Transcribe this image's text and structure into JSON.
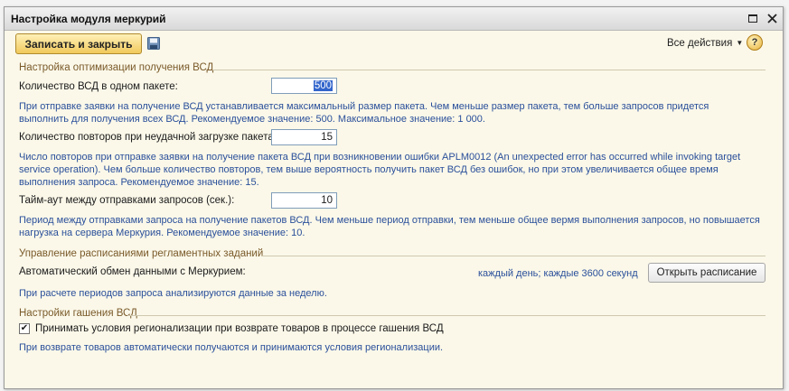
{
  "window": {
    "title": "Настройка модуля меркурий"
  },
  "toolbar": {
    "save_close_label": "Записать и закрыть",
    "all_actions_label": "Все действия",
    "help_label": "?"
  },
  "section_optimization": {
    "title": "Настройка оптимизации получения ВСД",
    "package_size_label": "Количество ВСД в одном пакете:",
    "package_size_value": "500",
    "package_size_hint_line1": "При отправке заявки на получение ВСД устанавливается максимальный размер пакета. Чем меньше размер пакета, тем больше запросов придется",
    "package_size_hint_line2": "выполнить для получения всех ВСД. Рекомендуемое значение: 500. Максимальное значение: 1 000.",
    "retries_label": "Количество повторов при неудачной загрузке пакета:",
    "retries_value": "15",
    "retries_hint_line1": "Число повторов при отправке заявки на получение пакета ВСД при возникновении ошибки APLM0012 (An unexpected error has occurred while invoking target",
    "retries_hint_line2": "service operation). Чем больше количество повторов, тем выше вероятность получить пакет ВСД без ошибок, но при этом увеличивается общее время",
    "retries_hint_line3": "выполнения запроса. Рекомендуемое значение: 15.",
    "timeout_label": "Тайм-аут между отправками запросов (сек.):",
    "timeout_value": "10",
    "timeout_hint_line1": "Период между отправками запроса на получение пакетов ВСД. Чем меньше период отправки, тем меньше общее вермя выполнения запросов, но повышается",
    "timeout_hint_line2": "нагрузка на сервера Меркурия. Рекомендуемое значение: 10."
  },
  "section_schedule": {
    "title": "Управление расписаниями регламентных заданий",
    "auto_exchange_label": "Автоматический обмен данными с Меркурием:",
    "schedule_value": "каждый день; каждые 3600 секунд",
    "open_schedule_button": "Открыть расписание",
    "hint": "При расчете периодов запроса анализируются данные за неделю."
  },
  "section_redemption": {
    "title": "Настройки гашения ВСД",
    "checkbox_label": "Принимать условия регионализации при возврате товаров в процессе гашения ВСД",
    "checkbox_checked": true,
    "hint": "При возврате товаров автоматически получаются и принимаются условия регионализации."
  }
}
